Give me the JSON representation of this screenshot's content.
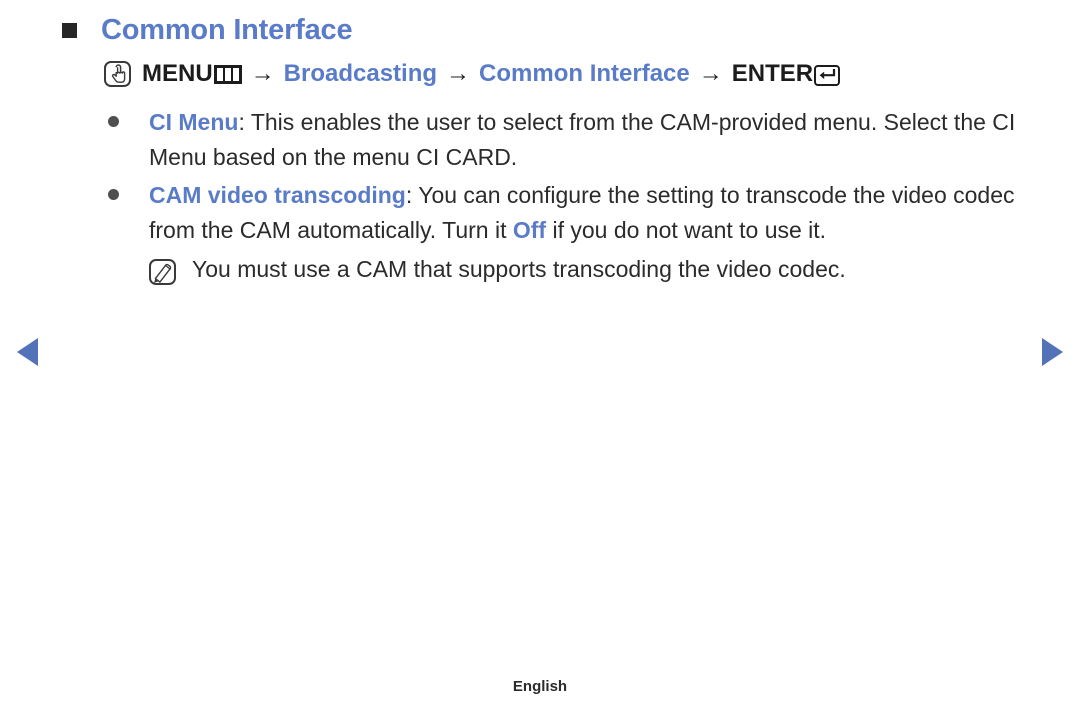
{
  "page": {
    "heading": "Common Interface",
    "footer_language": "English"
  },
  "menu_path": {
    "touch_icon": "touch-hand-icon",
    "menu_label": "MENU",
    "menu_icon": "menu-grid-icon",
    "arrow": "→",
    "step1": "Broadcasting",
    "step2": "Common Interface",
    "enter_label": "ENTER",
    "enter_icon": "enter-return-icon"
  },
  "bullets": [
    {
      "keyword": "CI Menu",
      "separator": ": ",
      "text": "This enables the user to select from the CAM-provided menu. Select the CI Menu based on the menu CI CARD."
    },
    {
      "keyword": "CAM video transcoding",
      "separator": ": ",
      "text_before": "You can configure the setting to transcode the video codec from the CAM automatically. Turn it ",
      "inline_keyword": "Off",
      "text_after": " if you do not want to use it."
    }
  ],
  "note": {
    "icon": "note-pencil-icon",
    "text": "You must use a CAM that supports transcoding the video codec."
  },
  "navigation": {
    "prev_icon": "triangle-left-icon",
    "next_icon": "triangle-right-icon"
  },
  "colors": {
    "accent_blue": "#5a7cc8",
    "nav_blue": "#5273b8",
    "body_text": "#2b2b2b"
  }
}
